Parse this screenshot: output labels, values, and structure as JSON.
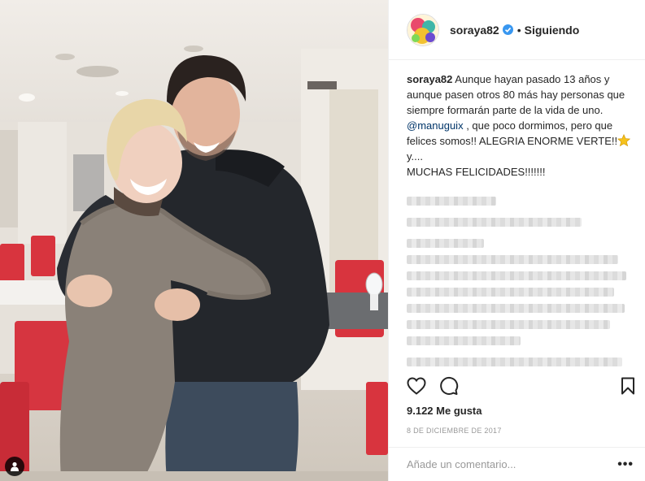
{
  "post": {
    "username": "soraya82",
    "follow_state": "Siguiendo",
    "separator": "•",
    "caption": {
      "username": "soraya82",
      "line1": " Aunque hayan pasado 13 años y aunque pasen otros 80 más hay personas que siempre formarán parte de la vida de uno.",
      "mention": "@manuguix",
      "line2": " , que poco dormimos, pero que felices somos!! ALEGRIA ENORME VERTE!!",
      "line2_end": " y....",
      "line3": "MUCHAS FELICIDADES!!!!!!!"
    },
    "likes": "9.122 Me gusta",
    "date": "8 DE DICIEMBRE DE 2017",
    "comment_placeholder": "Añade un comentario...",
    "more_options": "•••"
  },
  "icons": {
    "verified": "verified-badge-icon",
    "like": "heart-icon",
    "comment": "comment-bubble-icon",
    "save": "bookmark-icon",
    "tagged": "tagged-user-icon",
    "caption_emoji": "star-emoji-icon"
  },
  "colors": {
    "link": "#003569",
    "verified": "#3897f0",
    "muted": "#999999",
    "text": "#262626"
  }
}
